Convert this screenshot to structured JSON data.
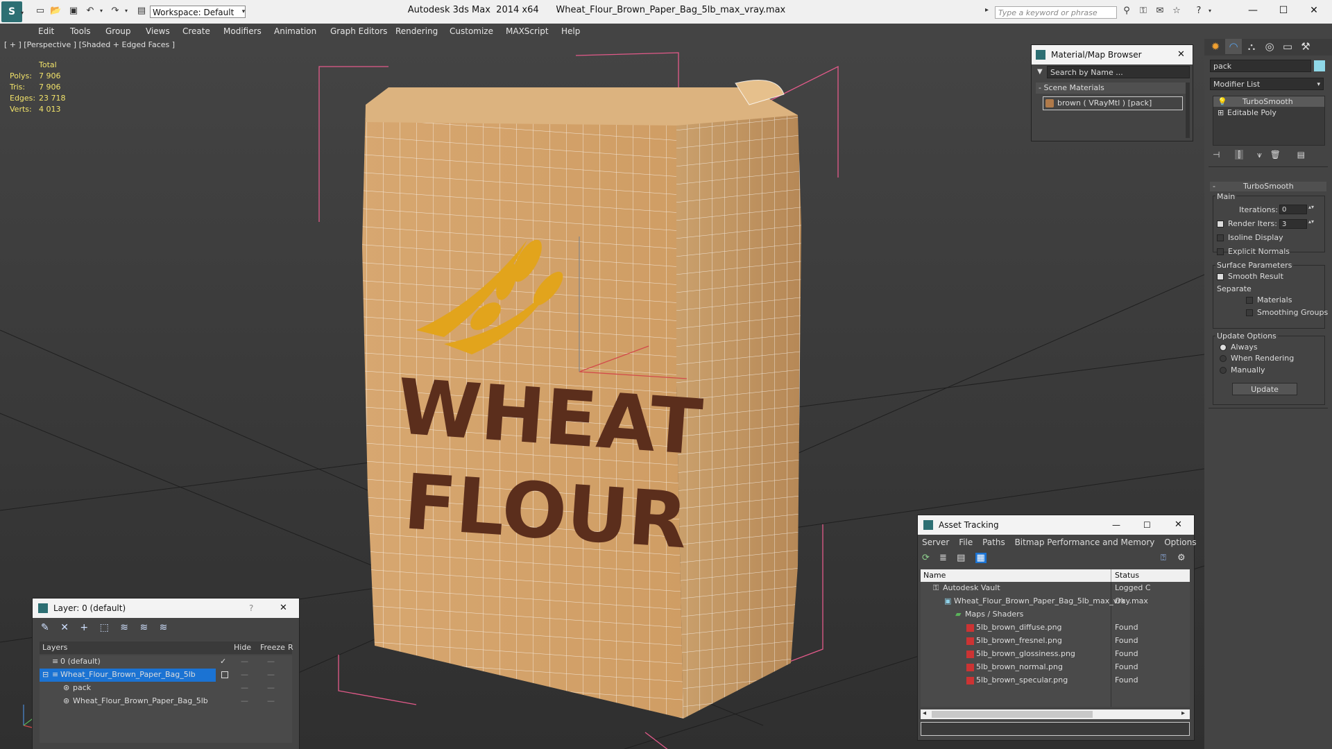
{
  "titlebar": {
    "workspace": "Workspace: Default",
    "app_title": "Autodesk 3ds Max  2014 x64      Wheat_Flour_Brown_Paper_Bag_5lb_max_vray.max",
    "search_placeholder": "Type a keyword or phrase"
  },
  "menu": [
    "Edit",
    "Tools",
    "Group",
    "Views",
    "Create",
    "Modifiers",
    "Animation",
    "Graph Editors",
    "Rendering",
    "Customize",
    "MAXScript",
    "Help"
  ],
  "viewport": {
    "label": "[ + ] [Perspective ] [Shaded + Edged Faces ]",
    "stats_header": "Total",
    "stats": [
      {
        "k": "Polys:",
        "v": "7 906"
      },
      {
        "k": "Tris:",
        "v": "7 906"
      },
      {
        "k": "Edges:",
        "v": "23 718"
      },
      {
        "k": "Verts:",
        "v": "4 013"
      }
    ],
    "bag_text_line1": "WHEAT",
    "bag_text_line2": "FLOUR",
    "colors": {
      "bag": "#d6a66f",
      "bag_dark": "#c08d57",
      "print": "#5b2e1c",
      "wheat": "#e2a41c",
      "bbox": "#e35a8a",
      "wire": "#ffffff"
    }
  },
  "material_browser": {
    "title": "Material/Map Browser",
    "search_placeholder": "Search by Name ...",
    "section": "- Scene Materials",
    "item": "brown  ( VRayMtl ) [pack]"
  },
  "command_panel": {
    "name_field": "pack",
    "modifier_list": "Modifier List",
    "stack": [
      "TurboSmooth",
      "Editable Poly"
    ],
    "rollout_title": "TurboSmooth",
    "main_label": "Main",
    "iterations_label": "Iterations:",
    "iterations_value": "0",
    "render_iters_label": "Render Iters:",
    "render_iters_value": "3",
    "isoline": "Isoline Display",
    "explicit_normals": "Explicit Normals",
    "surface_params": "Surface Parameters",
    "smooth_result": "Smooth Result",
    "separate": "Separate",
    "materials": "Materials",
    "smoothing_groups": "Smoothing Groups",
    "update_options": "Update Options",
    "always": "Always",
    "when_rendering": "When Rendering",
    "manually": "Manually",
    "update_button": "Update"
  },
  "layer_window": {
    "title": "Layer: 0 (default)",
    "help": "?",
    "columns": {
      "layers": "Layers",
      "hide": "Hide",
      "freeze": "Freeze",
      "r": "R"
    },
    "rows": [
      {
        "name": "0 (default)",
        "indent": 0
      },
      {
        "name": "Wheat_Flour_Brown_Paper_Bag_5lb",
        "indent": 0
      },
      {
        "name": "pack",
        "indent": 1
      },
      {
        "name": "Wheat_Flour_Brown_Paper_Bag_5lb",
        "indent": 1
      }
    ]
  },
  "asset_tracking": {
    "title": "Asset Tracking",
    "menu": [
      "Server",
      "File",
      "Paths",
      "Bitmap Performance and Memory",
      "Options"
    ],
    "columns": {
      "name": "Name",
      "status": "Status"
    },
    "rows": [
      {
        "name": "Autodesk Vault",
        "status": "Logged C"
      },
      {
        "name": "Wheat_Flour_Brown_Paper_Bag_5lb_max_vray.max",
        "status": "Ok"
      },
      {
        "name": "Maps / Shaders",
        "status": ""
      },
      {
        "name": "5lb_brown_diffuse.png",
        "status": "Found"
      },
      {
        "name": "5lb_brown_fresnel.png",
        "status": "Found"
      },
      {
        "name": "5lb_brown_glossiness.png",
        "status": "Found"
      },
      {
        "name": "5lb_brown_normal.png",
        "status": "Found"
      },
      {
        "name": "5lb_brown_specular.png",
        "status": "Found"
      }
    ]
  }
}
